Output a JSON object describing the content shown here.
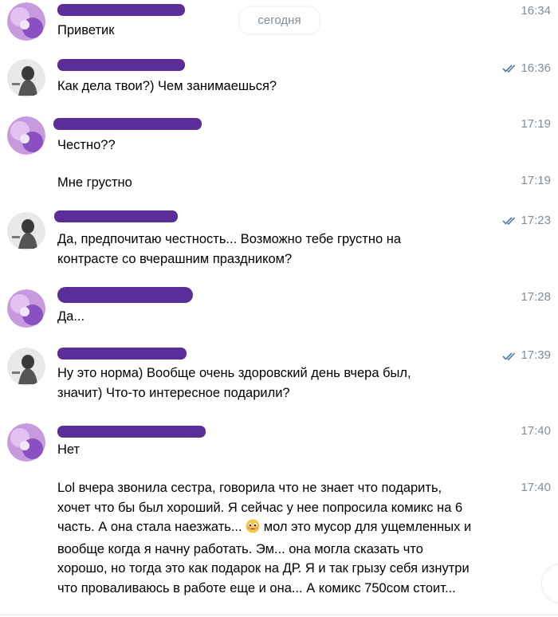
{
  "date_separator": "сегодня",
  "colors": {
    "redaction": "#5b2d98",
    "meta": "#818c99",
    "read_check": "#4a76a8"
  },
  "messages": [
    {
      "sender": "contact",
      "time": "16:34",
      "text": "Приветик",
      "read": false
    },
    {
      "sender": "self",
      "time": "16:36",
      "text": "Как дела твои?) Чем занимаешься?",
      "read": true
    },
    {
      "sender": "contact",
      "time": "17:19",
      "text": "Честно??",
      "read": false
    },
    {
      "sender": "contact",
      "time": "17:19",
      "text": "Мне грустно",
      "read": false
    },
    {
      "sender": "self",
      "time": "17:23",
      "text": "Да, предпочитаю честность... Возможно тебе грустно на\nконтрасте со вчерашним праздником?",
      "read": true
    },
    {
      "sender": "contact",
      "time": "17:28",
      "text": "Да...",
      "read": false
    },
    {
      "sender": "self",
      "time": "17:39",
      "text": "Ну это норма) Вообще очень здоровский день вчера был,\nзначит) Что-то интересное подарили?",
      "read": true
    },
    {
      "sender": "contact",
      "time": "17:40",
      "text": "Нет",
      "read": false
    },
    {
      "sender": "contact",
      "time": "17:40",
      "text_before_emoji": "Lol вчера звонила сестра, говорила что не знает что подарить,\nхочет что бы был хороший. Я сейчас у нее попросила комикс на 6\nчасть. А она стала наезжать... ",
      "emoji": "pleading-face",
      "text_after_emoji": " мол это мусор для ущемленных и\nвообще когда я начну работать. Эм... она могла сказать что\nхорошо, но тогда это как подарок на ДР. Я и так грызу себя изнутри\nчто проваливаюсь в работе еще и она... А комикс 750сом стоит...",
      "read": false
    }
  ]
}
